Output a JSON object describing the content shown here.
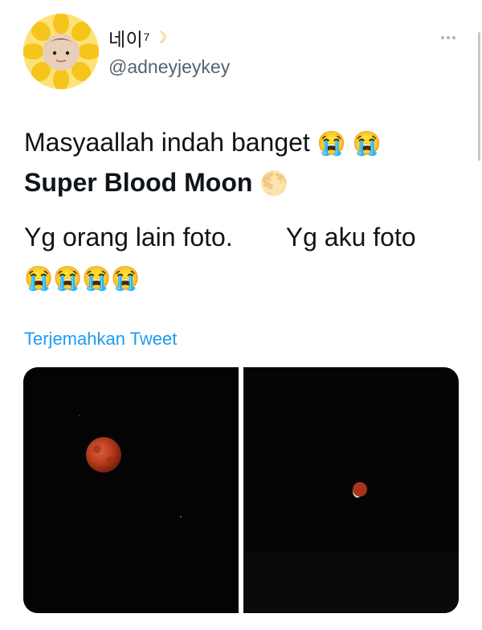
{
  "tweet": {
    "display_name": "네이⁷",
    "name_glyph": "☽",
    "handle": "@adneyjeykey",
    "lines": {
      "l1_text": "Masyaallah indah banget",
      "l1_emoji": "😭 😭",
      "l2_text": "Super Blood Moon",
      "l2_emoji": "🌕",
      "l3_left": "Yg orang lain foto.",
      "l3_right": "Yg aku foto",
      "l4_emoji": "😭😭😭😭"
    },
    "translate_label": "Terjemahkan Tweet"
  },
  "icons": {
    "more": "more-horizontal-icon",
    "verified_moon": "crescent-moon-icon"
  },
  "colors": {
    "link": "#1d9bf0",
    "handle": "#536471",
    "moon_red": "#b53a1c"
  }
}
